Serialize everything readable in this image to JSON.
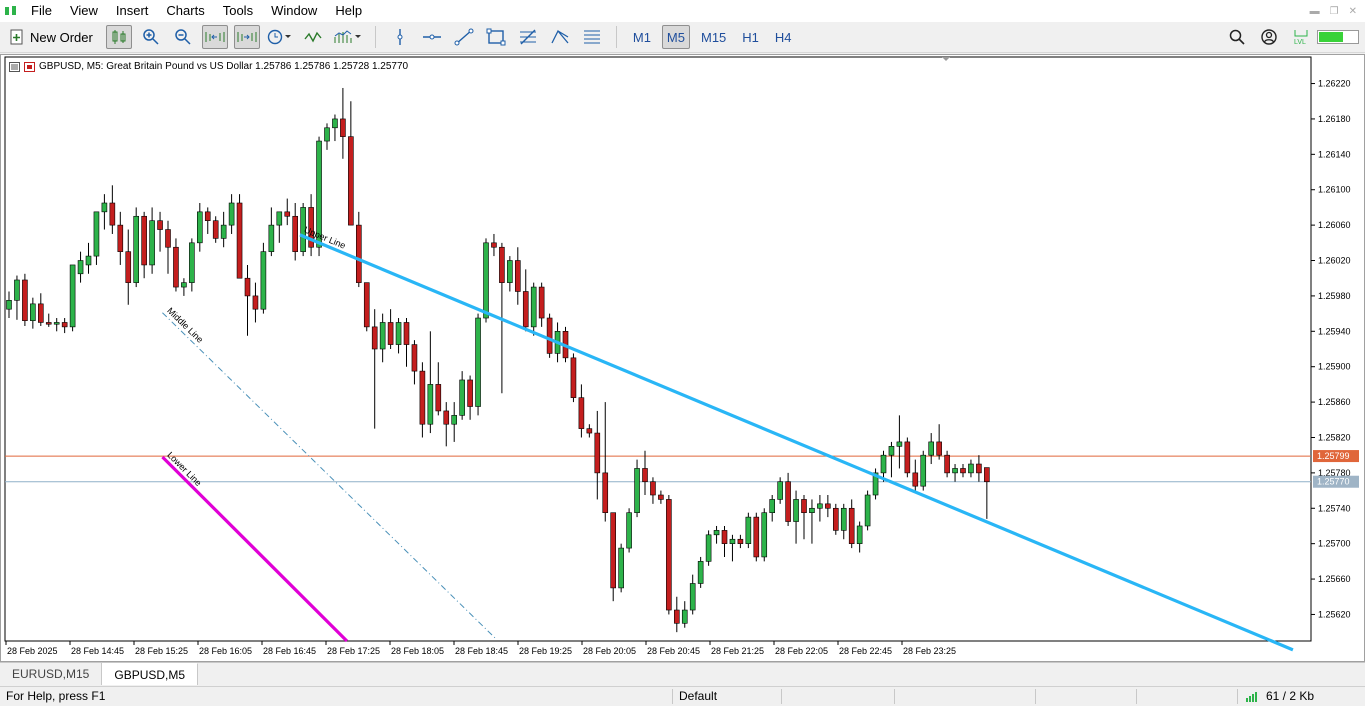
{
  "menu": [
    "File",
    "View",
    "Insert",
    "Charts",
    "Tools",
    "Window",
    "Help"
  ],
  "toolbar": {
    "new_order_label": "New Order",
    "timeframes": [
      "M1",
      "M5",
      "M15",
      "H1",
      "H4"
    ],
    "active_timeframe": "M5"
  },
  "chart": {
    "symbol_line": "GBPUSD, M5:  Great Britain Pound vs US Dollar  1.25786 1.25786 1.25728 1.25770",
    "bid_label": "1.25799",
    "ask_label": "1.25770",
    "colors": {
      "bull": "#2db34a",
      "bear": "#c41e1e",
      "upper_line": "#29b6f6",
      "lower_line": "#e000d6",
      "middle_line": "#4a90b8",
      "bid_line": "#e0663a",
      "ask_line": "#8fb0c8"
    },
    "annotations": {
      "upper": "Upper Line",
      "middle": "Middle Line",
      "lower": "Lower Line"
    }
  },
  "chart_data": {
    "type": "candlestick",
    "y_ticks": [
      "1.26220",
      "1.26180",
      "1.26140",
      "1.26100",
      "1.26060",
      "1.26020",
      "1.25980",
      "1.25940",
      "1.25900",
      "1.25860",
      "1.25820",
      "1.25780",
      "1.25740",
      "1.25700",
      "1.25660",
      "1.25620"
    ],
    "x_ticks": [
      "28 Feb 2025",
      "28 Feb 14:45",
      "28 Feb 15:25",
      "28 Feb 16:05",
      "28 Feb 16:45",
      "28 Feb 17:25",
      "28 Feb 18:05",
      "28 Feb 18:45",
      "28 Feb 19:25",
      "28 Feb 20:05",
      "28 Feb 20:45",
      "28 Feb 21:25",
      "28 Feb 22:05",
      "28 Feb 22:45",
      "28 Feb 23:25"
    ],
    "ylim": [
      1.2559,
      1.2625
    ],
    "channel": {
      "upper": [
        [
          36.6,
          1.26049
        ],
        [
          161.5,
          1.2558
        ]
      ],
      "lower": [
        [
          19.3,
          1.25798
        ],
        [
          42.5,
          1.2559
        ]
      ],
      "middle": [
        [
          19.3,
          1.25961
        ],
        [
          61.3,
          1.25592
        ]
      ]
    },
    "candles_ohlc": [
      [
        1.25965,
        1.25985,
        1.25955,
        1.25975
      ],
      [
        1.25975,
        1.26003,
        1.25953,
        1.25998
      ],
      [
        1.25998,
        1.26005,
        1.25946,
        1.25952
      ],
      [
        1.25952,
        1.25978,
        1.25943,
        1.25971
      ],
      [
        1.25971,
        1.25983,
        1.25946,
        1.2595
      ],
      [
        1.2595,
        1.2596,
        1.25945,
        1.25948
      ],
      [
        1.25948,
        1.25955,
        1.2594,
        1.2595
      ],
      [
        1.2595,
        1.25955,
        1.25938,
        1.25945
      ],
      [
        1.25945,
        1.2599,
        1.2594,
        1.26015
      ],
      [
        1.26005,
        1.2603,
        1.25995,
        1.2602
      ],
      [
        1.26015,
        1.2604,
        1.26005,
        1.26025
      ],
      [
        1.26025,
        1.2607,
        1.26015,
        1.26075
      ],
      [
        1.26075,
        1.26095,
        1.26055,
        1.26085
      ],
      [
        1.26085,
        1.26105,
        1.2605,
        1.2606
      ],
      [
        1.2606,
        1.26075,
        1.26015,
        1.2603
      ],
      [
        1.2603,
        1.26055,
        1.2597,
        1.25995
      ],
      [
        1.25995,
        1.2608,
        1.2599,
        1.2607
      ],
      [
        1.2607,
        1.26075,
        1.26,
        1.26015
      ],
      [
        1.26015,
        1.2608,
        1.26005,
        1.26065
      ],
      [
        1.26065,
        1.26075,
        1.2603,
        1.26055
      ],
      [
        1.26055,
        1.26065,
        1.26005,
        1.26035
      ],
      [
        1.26035,
        1.26045,
        1.25985,
        1.2599
      ],
      [
        1.2599,
        1.26,
        1.2598,
        1.25995
      ],
      [
        1.25995,
        1.26045,
        1.25985,
        1.2604
      ],
      [
        1.2604,
        1.26085,
        1.2603,
        1.26075
      ],
      [
        1.26075,
        1.2608,
        1.2605,
        1.26065
      ],
      [
        1.26065,
        1.2607,
        1.2604,
        1.26045
      ],
      [
        1.26045,
        1.26075,
        1.26035,
        1.2606
      ],
      [
        1.2606,
        1.26095,
        1.2605,
        1.26085
      ],
      [
        1.26085,
        1.26095,
        1.26,
        1.26
      ],
      [
        1.26,
        1.26015,
        1.25935,
        1.2598
      ],
      [
        1.2598,
        1.25995,
        1.2595,
        1.25965
      ],
      [
        1.25965,
        1.2604,
        1.2596,
        1.2603
      ],
      [
        1.2603,
        1.2608,
        1.26025,
        1.2606
      ],
      [
        1.2606,
        1.26075,
        1.2604,
        1.26075
      ],
      [
        1.26075,
        1.2609,
        1.2606,
        1.2607
      ],
      [
        1.2607,
        1.26085,
        1.2602,
        1.2603
      ],
      [
        1.2603,
        1.26085,
        1.26025,
        1.2608
      ],
      [
        1.2608,
        1.26095,
        1.26025,
        1.26035
      ],
      [
        1.26035,
        1.2616,
        1.26025,
        1.26155
      ],
      [
        1.26155,
        1.26175,
        1.26145,
        1.2617
      ],
      [
        1.2617,
        1.26185,
        1.26155,
        1.2618
      ],
      [
        1.2618,
        1.26215,
        1.26135,
        1.2616
      ],
      [
        1.2616,
        1.262,
        1.2606,
        1.2606
      ],
      [
        1.2606,
        1.26075,
        1.2599,
        1.25995
      ],
      [
        1.25995,
        1.25995,
        1.2594,
        1.25945
      ],
      [
        1.25945,
        1.25965,
        1.2583,
        1.2592
      ],
      [
        1.2592,
        1.2596,
        1.25905,
        1.2595
      ],
      [
        1.2595,
        1.25965,
        1.2592,
        1.25925
      ],
      [
        1.25925,
        1.25955,
        1.25915,
        1.2595
      ],
      [
        1.2595,
        1.25955,
        1.259,
        1.25925
      ],
      [
        1.25925,
        1.2593,
        1.2588,
        1.25895
      ],
      [
        1.25895,
        1.25905,
        1.2582,
        1.25835
      ],
      [
        1.25835,
        1.2594,
        1.25825,
        1.2588
      ],
      [
        1.2588,
        1.25905,
        1.25845,
        1.2585
      ],
      [
        1.2585,
        1.2586,
        1.2581,
        1.25835
      ],
      [
        1.25835,
        1.2586,
        1.25815,
        1.25845
      ],
      [
        1.25845,
        1.25895,
        1.2584,
        1.25885
      ],
      [
        1.25885,
        1.2589,
        1.2584,
        1.25855
      ],
      [
        1.25855,
        1.2596,
        1.25845,
        1.25955
      ],
      [
        1.25955,
        1.26045,
        1.2595,
        1.2604
      ],
      [
        1.2604,
        1.2605,
        1.26025,
        1.26035
      ],
      [
        1.26035,
        1.2604,
        1.2587,
        1.25995
      ],
      [
        1.25995,
        1.26025,
        1.25985,
        1.2602
      ],
      [
        1.2602,
        1.26035,
        1.2597,
        1.25985
      ],
      [
        1.25985,
        1.2601,
        1.2594,
        1.25945
      ],
      [
        1.25945,
        1.25995,
        1.25935,
        1.2599
      ],
      [
        1.2599,
        1.25995,
        1.25945,
        1.25955
      ],
      [
        1.25955,
        1.2596,
        1.2591,
        1.25915
      ],
      [
        1.25915,
        1.2595,
        1.25905,
        1.2594
      ],
      [
        1.2594,
        1.25945,
        1.25905,
        1.2591
      ],
      [
        1.2591,
        1.25915,
        1.2586,
        1.25865
      ],
      [
        1.25865,
        1.2588,
        1.2582,
        1.2583
      ],
      [
        1.2583,
        1.25835,
        1.2582,
        1.25825
      ],
      [
        1.25825,
        1.2585,
        1.2575,
        1.2578
      ],
      [
        1.2578,
        1.2586,
        1.25725,
        1.25735
      ],
      [
        1.25735,
        1.25735,
        1.25635,
        1.2565
      ],
      [
        1.2565,
        1.257,
        1.25645,
        1.25695
      ],
      [
        1.25695,
        1.2574,
        1.2569,
        1.25735
      ],
      [
        1.25735,
        1.25795,
        1.2573,
        1.25785
      ],
      [
        1.25785,
        1.25805,
        1.25755,
        1.2577
      ],
      [
        1.2577,
        1.25775,
        1.25745,
        1.25755
      ],
      [
        1.25755,
        1.2576,
        1.25745,
        1.2575
      ],
      [
        1.2575,
        1.25755,
        1.2562,
        1.25625
      ],
      [
        1.25625,
        1.2564,
        1.256,
        1.2561
      ],
      [
        1.2561,
        1.25635,
        1.25605,
        1.25625
      ],
      [
        1.25625,
        1.25665,
        1.2562,
        1.25655
      ],
      [
        1.25655,
        1.25685,
        1.2565,
        1.2568
      ],
      [
        1.2568,
        1.25715,
        1.25675,
        1.2571
      ],
      [
        1.2571,
        1.2572,
        1.257,
        1.25715
      ],
      [
        1.25715,
        1.2572,
        1.25685,
        1.257
      ],
      [
        1.257,
        1.2571,
        1.2568,
        1.25705
      ],
      [
        1.25705,
        1.2571,
        1.25695,
        1.257
      ],
      [
        1.257,
        1.25735,
        1.25695,
        1.2573
      ],
      [
        1.2573,
        1.25735,
        1.2568,
        1.25685
      ],
      [
        1.25685,
        1.2574,
        1.2568,
        1.25735
      ],
      [
        1.25735,
        1.25755,
        1.25725,
        1.2575
      ],
      [
        1.2575,
        1.25775,
        1.25745,
        1.2577
      ],
      [
        1.2577,
        1.2578,
        1.2572,
        1.25725
      ],
      [
        1.25725,
        1.2576,
        1.257,
        1.2575
      ],
      [
        1.2575,
        1.25755,
        1.25705,
        1.25735
      ],
      [
        1.25735,
        1.2575,
        1.257,
        1.2574
      ],
      [
        1.2574,
        1.25755,
        1.25725,
        1.25745
      ],
      [
        1.25745,
        1.25755,
        1.2573,
        1.2574
      ],
      [
        1.2574,
        1.25745,
        1.2571,
        1.25715
      ],
      [
        1.25715,
        1.25745,
        1.25705,
        1.2574
      ],
      [
        1.2574,
        1.2575,
        1.25695,
        1.257
      ],
      [
        1.257,
        1.25725,
        1.2569,
        1.2572
      ],
      [
        1.2572,
        1.2576,
        1.25715,
        1.25755
      ],
      [
        1.25755,
        1.25785,
        1.2575,
        1.2578
      ],
      [
        1.2578,
        1.25805,
        1.2577,
        1.258
      ],
      [
        1.258,
        1.25815,
        1.25775,
        1.2581
      ],
      [
        1.2581,
        1.25845,
        1.25785,
        1.25815
      ],
      [
        1.25815,
        1.2582,
        1.25775,
        1.2578
      ],
      [
        1.2578,
        1.25795,
        1.2576,
        1.25765
      ],
      [
        1.25765,
        1.25805,
        1.2576,
        1.258
      ],
      [
        1.258,
        1.25825,
        1.2579,
        1.25815
      ],
      [
        1.25815,
        1.25835,
        1.25795,
        1.258
      ],
      [
        1.258,
        1.25805,
        1.25775,
        1.2578
      ],
      [
        1.2578,
        1.2579,
        1.2577,
        1.25785
      ],
      [
        1.25785,
        1.2579,
        1.25775,
        1.2578
      ],
      [
        1.2578,
        1.25795,
        1.25775,
        1.2579
      ],
      [
        1.2579,
        1.258,
        1.2577,
        1.2578
      ],
      [
        1.25786,
        1.25786,
        1.25728,
        1.2577
      ]
    ]
  },
  "tabs": [
    "EURUSD,M15",
    "GBPUSD,M5"
  ],
  "active_tab": "GBPUSD,M5",
  "status": {
    "help": "For Help, press F1",
    "profile": "Default",
    "traffic": "61 / 2 Kb"
  }
}
